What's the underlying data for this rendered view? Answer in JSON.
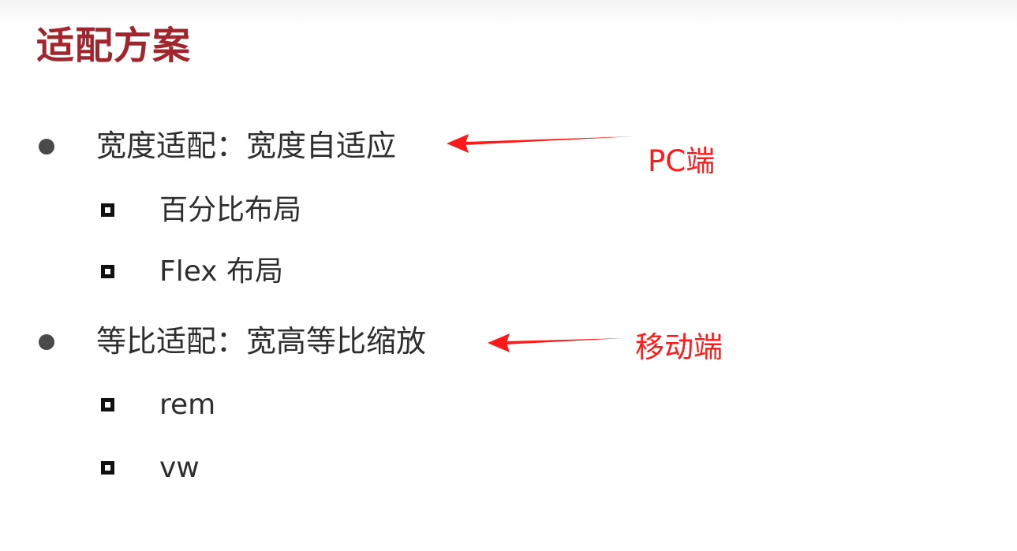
{
  "slide": {
    "title": "适配方案",
    "title_color": "#a0252d",
    "sections": [
      {
        "label": "宽度适配：宽度自适应",
        "items": [
          "百分比布局",
          "Flex 布局"
        ]
      },
      {
        "label": "等比适配：宽高等比缩放",
        "items": [
          "rem",
          "vw"
        ]
      }
    ]
  },
  "annotations": {
    "color": "#ff1a1a",
    "pc": "PC端",
    "mobile": "移动端"
  }
}
